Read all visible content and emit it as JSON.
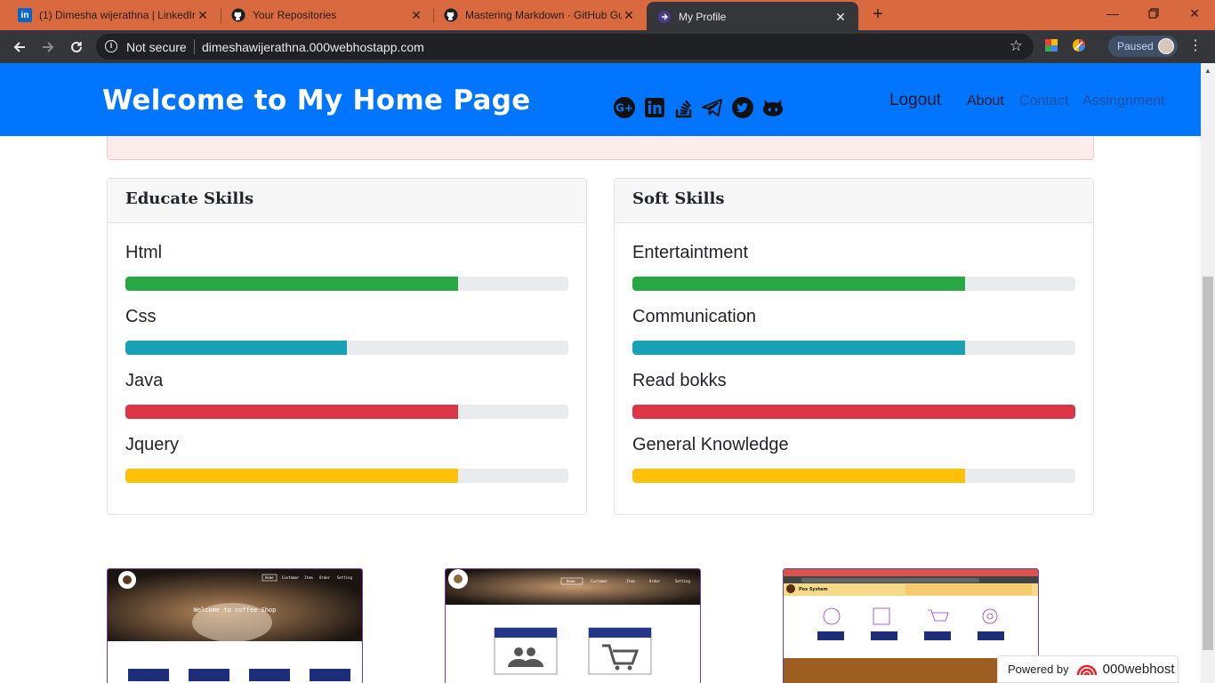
{
  "browser": {
    "tabs": [
      {
        "title": "(1) Dimesha wijerathna | LinkedIn",
        "icon": "linkedin-icon"
      },
      {
        "title": "Your Repositories",
        "icon": "github-icon"
      },
      {
        "title": "Mastering Markdown · GitHub Gu",
        "icon": "github-icon"
      },
      {
        "title": "My Profile",
        "icon": "page-icon",
        "active": true
      }
    ],
    "security_label": "Not secure",
    "url": "dimeshawijerathna.000webhostapp.com",
    "profile_status": "Paused"
  },
  "navbar": {
    "brand": "Welcome to My Home Page",
    "social_icons": [
      "google-plus-icon",
      "linkedin-icon",
      "stackoverflow-icon",
      "telegram-icon",
      "twitter-icon",
      "github-icon"
    ],
    "logout": "Logout",
    "links": [
      "About",
      "Contact",
      "Assingnment"
    ],
    "color": "#0275fe"
  },
  "educate_skills": {
    "title": "Educate Skills",
    "items": [
      {
        "name": "Html",
        "percent": 75,
        "color": "#28a745"
      },
      {
        "name": "Css",
        "percent": 50,
        "color": "#17a2b8"
      },
      {
        "name": "Java",
        "percent": 75,
        "color": "#dc3545"
      },
      {
        "name": "Jquery",
        "percent": 75,
        "color": "#ffc107"
      }
    ]
  },
  "soft_skills": {
    "title": "Soft Skills",
    "items": [
      {
        "name": "Entertaintment",
        "percent": 75,
        "color": "#28a745"
      },
      {
        "name": "Communication",
        "percent": 75,
        "color": "#17a2b8"
      },
      {
        "name": "Read bokks",
        "percent": 100,
        "color": "#dc3545"
      },
      {
        "name": "General Knowledge",
        "percent": 75,
        "color": "#ffc107"
      }
    ]
  },
  "projects": [
    {
      "caption": "Welcome to coffee Shop"
    },
    {},
    {
      "caption": "Pos System"
    }
  ],
  "footer_badge": {
    "prefix": "Powered by",
    "brand": "000webhost"
  }
}
